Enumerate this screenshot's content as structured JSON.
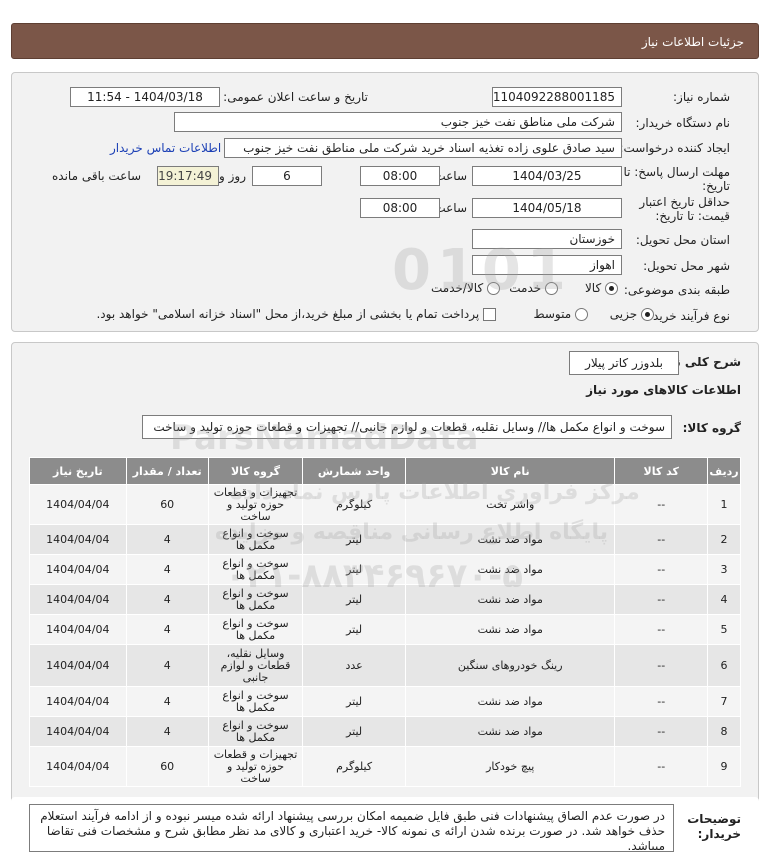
{
  "header": {
    "title": "جزئیات اطلاعات نیاز"
  },
  "info": {
    "need_number_label": "شماره نیاز:",
    "need_number": "1104092288001185",
    "announce_label": "تاریخ و ساعت اعلان عمومی:",
    "announce_value": "1404/03/18 - 11:54",
    "buyer_org_label": "نام دستگاه خریدار:",
    "buyer_org": "شرکت ملی مناطق نفت خیز جنوب",
    "creator_label": "ایجاد کننده درخواست:",
    "creator": "سید صادق علوی زاده  تغذیه اسناد خرید  شرکت ملی مناطق نفت خیز جنوب",
    "contact_link": "اطلاعات تماس خریدار",
    "deadline_label_1": "مهلت ارسال پاسخ: تا",
    "deadline_label_2": "تاریخ:",
    "deadline_date": "1404/03/25",
    "time_label": "ساعت",
    "deadline_time": "08:00",
    "days_value": "6",
    "days_label": "روز و",
    "remaining_time": "19:17:49",
    "remaining_label": "ساعت باقی مانده",
    "validity_label_1": "حداقل تاریخ اعتبار",
    "validity_label_2": "قیمت: تا تاریخ:",
    "validity_date": "1404/05/18",
    "validity_time": "08:00",
    "province_label": "استان محل تحویل:",
    "province": "خوزستان",
    "city_label": "شهر محل تحویل:",
    "city": "اهواز",
    "category_label": "طبقه بندی موضوعی:",
    "category_options": [
      "کالا",
      "خدمت",
      "کالا/خدمت"
    ],
    "process_label": "نوع فرآیند خرید :",
    "process_options": [
      "جزیی",
      "متوسط"
    ],
    "payment_note": "پرداخت تمام یا بخشی از مبلغ خرید،از محل \"اسناد خزانه اسلامی\" خواهد بود."
  },
  "general": {
    "desc_label": "شرح کلی نیاز:",
    "desc_value": "بلدوزر کاتر پیلار",
    "goods_title": "اطلاعات کالاهای مورد نیاز",
    "group_label": "گروه کالا:",
    "group_value": "سوخت و انواع مکمل ها// وسایل نقلیه، قطعات و لوازم جانبی// تجهیزات و قطعات حوزه تولید و ساخت"
  },
  "table": {
    "headers": [
      "ردیف",
      "کد کالا",
      "نام کالا",
      "واحد شمارش",
      "گروه کالا",
      "تعداد / مقدار",
      "تاریخ نیاز"
    ],
    "rows": [
      [
        "1",
        "--",
        "واشر تخت",
        "کیلوگرم",
        "تجهیزات و قطعات حوزه تولید و ساخت",
        "60",
        "1404/04/04"
      ],
      [
        "2",
        "--",
        "مواد ضد نشت",
        "لیتر",
        "سوخت و انواع مکمل ها",
        "4",
        "1404/04/04"
      ],
      [
        "3",
        "--",
        "مواد ضد نشت",
        "لیتر",
        "سوخت و انواع مکمل ها",
        "4",
        "1404/04/04"
      ],
      [
        "4",
        "--",
        "مواد ضد نشت",
        "لیتر",
        "سوخت و انواع مکمل ها",
        "4",
        "1404/04/04"
      ],
      [
        "5",
        "--",
        "مواد ضد نشت",
        "لیتر",
        "سوخت و انواع مکمل ها",
        "4",
        "1404/04/04"
      ],
      [
        "6",
        "--",
        "رینگ خودروهای سنگین",
        "عدد",
        "وسایل نقلیه، قطعات و لوازم جانبی",
        "4",
        "1404/04/04"
      ],
      [
        "7",
        "--",
        "مواد ضد نشت",
        "لیتر",
        "سوخت و انواع مکمل ها",
        "4",
        "1404/04/04"
      ],
      [
        "8",
        "--",
        "مواد ضد نشت",
        "لیتر",
        "سوخت و انواع مکمل ها",
        "4",
        "1404/04/04"
      ],
      [
        "9",
        "--",
        "پیچ خودکار",
        "کیلوگرم",
        "تجهیزات و قطعات حوزه تولید و ساخت",
        "60",
        "1404/04/04"
      ]
    ]
  },
  "notes": {
    "label_1": "توضیحات",
    "label_2": "خریدار:",
    "text": "در صورت عدم الصاق پیشنهادات فنی طبق فایل ضمیمه امکان بررسی پیشنهاد ارائه شده میسر نبوده و از ادامه فرآیند استعلام حذف خواهد شد. در صورت برنده شدن ارائه ی نمونه کالا- خرید اعتباری و کالای مد نظر مطابق شرح و مشخصات فنی تقاضا میباشد."
  },
  "watermark": {
    "text_1": "ParsNamadData",
    "text_2": "مرکز فراوری اطلاعات پارس نماد داده",
    "text_3": "پایگاه اطلاع رسانی مناقصه و مزایده",
    "text_4": "۰۲۱-۸۸۳۴۶۹۶۷۰-۵"
  }
}
